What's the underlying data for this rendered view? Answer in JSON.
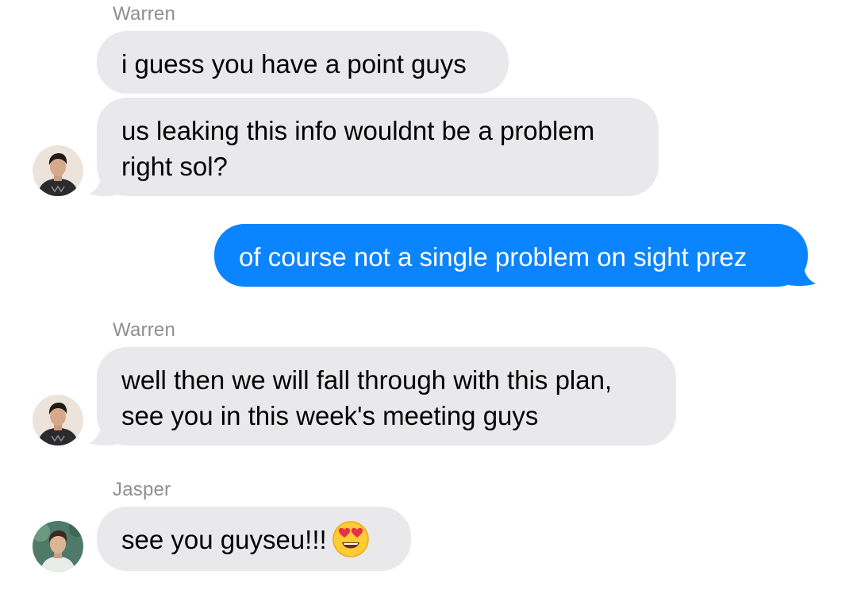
{
  "colors": {
    "incoming_bubble": "#e9e9eb",
    "outgoing_bubble": "#0a84ff",
    "sender_name": "#8e8e93"
  },
  "messages": [
    {
      "sender": "Warren",
      "text": "i guess you have a point guys"
    },
    {
      "lines": [
        "us leaking this info wouldnt be a problem",
        "right sol?"
      ]
    },
    {
      "text": "of course not a single problem on sight prez"
    },
    {
      "sender": "Warren",
      "lines": [
        "well then we will fall through with this plan,",
        "see you in this week's meeting guys"
      ]
    },
    {
      "sender": "Jasper",
      "text": "see you guyseu!!!",
      "emoji": "heart-eyes-emoji"
    }
  ]
}
